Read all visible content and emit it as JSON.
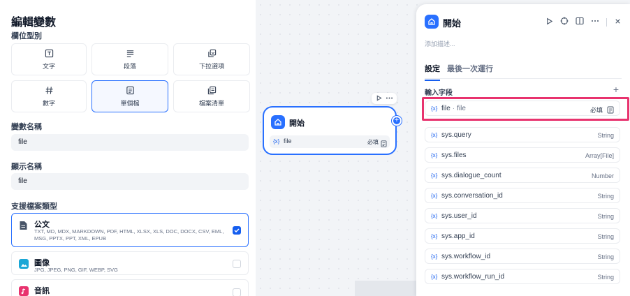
{
  "left_panel": {
    "title": "編輯變數",
    "field_type_label": "欄位型別",
    "field_types": [
      {
        "label": "文字",
        "icon": "text-box-icon",
        "active": false
      },
      {
        "label": "段落",
        "icon": "paragraph-icon",
        "active": false
      },
      {
        "label": "下拉選項",
        "icon": "dropdown-options-icon",
        "active": false
      },
      {
        "label": "數字",
        "icon": "hash-icon",
        "active": false
      },
      {
        "label": "單個檔",
        "icon": "document-icon",
        "active": true
      },
      {
        "label": "檔案清單",
        "icon": "file-list-icon",
        "active": false
      }
    ],
    "variable_name_label": "變數名稱",
    "variable_name_value": "file",
    "display_name_label": "顯示名稱",
    "display_name_value": "file",
    "supported_types_label": "支援檔案類型",
    "file_types": [
      {
        "name": "公文",
        "extensions": "TXT, MD, MDX, MARKDOWN, PDF, HTML, XLSX, XLS, DOC, DOCX, CSV, EML, MSG, PPTX, PPT, XML, EPUB",
        "checked": true,
        "color": "#475467"
      },
      {
        "name": "圖像",
        "extensions": "JPG, JPEG, PNG, GIF, WEBP, SVG",
        "checked": false,
        "color": "#1aa7d6"
      },
      {
        "name": "音訊",
        "extensions": "",
        "checked": false,
        "color": "#e8336e"
      }
    ]
  },
  "node": {
    "title": "開始",
    "var_prefix": "{x}",
    "var_name": "file",
    "required": "必填"
  },
  "right_panel": {
    "title": "開始",
    "description_placeholder": "添加描述...",
    "tabs": [
      {
        "label": "設定",
        "active": true
      },
      {
        "label": "最後一次運行",
        "active": false
      }
    ],
    "input_fields_label": "輸入字段",
    "var_prefix": "{x}",
    "file_row": {
      "name": "file",
      "separator": "·",
      "label": "file",
      "required": "必填"
    },
    "sys_vars": [
      {
        "name": "sys.query",
        "type": "String"
      },
      {
        "name": "sys.files",
        "type": "Array[File]"
      },
      {
        "name": "sys.dialogue_count",
        "type": "Number"
      },
      {
        "name": "sys.conversation_id",
        "type": "String"
      },
      {
        "name": "sys.user_id",
        "type": "String"
      },
      {
        "name": "sys.app_id",
        "type": "String"
      },
      {
        "name": "sys.workflow_id",
        "type": "String"
      },
      {
        "name": "sys.workflow_run_id",
        "type": "String"
      }
    ]
  },
  "colors": {
    "accent": "#2970ff",
    "highlight": "#e8336e"
  }
}
